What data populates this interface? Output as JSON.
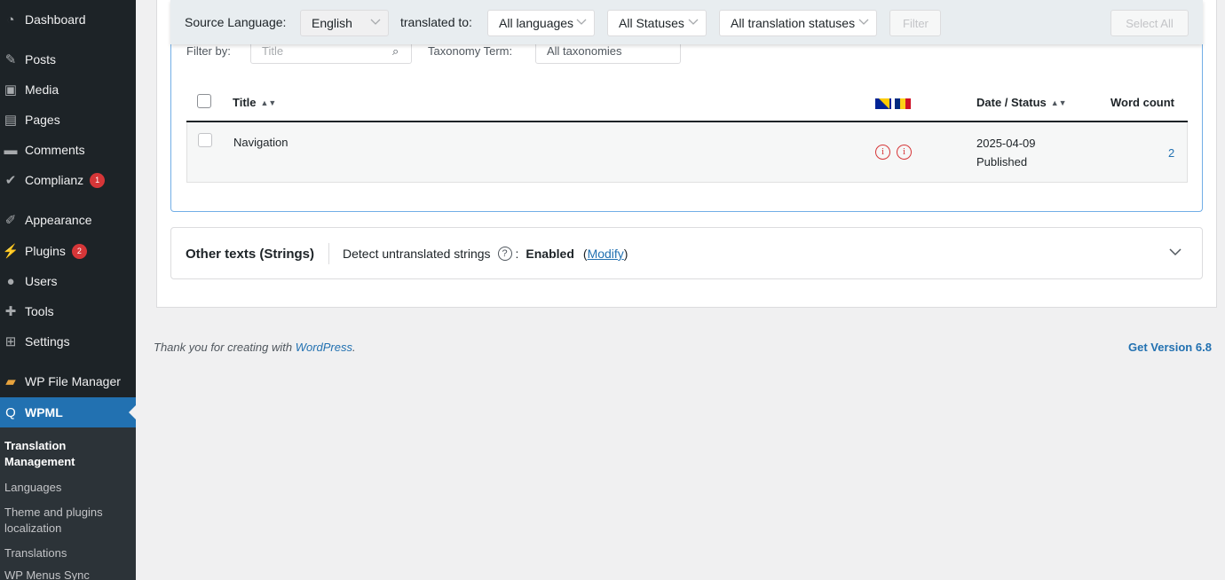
{
  "sidebar": {
    "items": [
      {
        "label": "Dashboard",
        "icon": "dashboard-icon"
      },
      {
        "label": "Posts",
        "icon": "pin-icon"
      },
      {
        "label": "Media",
        "icon": "media-icon"
      },
      {
        "label": "Pages",
        "icon": "page-icon"
      },
      {
        "label": "Comments",
        "icon": "comment-icon"
      },
      {
        "label": "Complianz",
        "icon": "check-icon",
        "badge": "1"
      },
      {
        "label": "Appearance",
        "icon": "brush-icon"
      },
      {
        "label": "Plugins",
        "icon": "plug-icon",
        "badge": "2"
      },
      {
        "label": "Users",
        "icon": "user-icon"
      },
      {
        "label": "Tools",
        "icon": "wrench-icon"
      },
      {
        "label": "Settings",
        "icon": "settings-icon"
      },
      {
        "label": "WP File Manager",
        "icon": "folder-icon"
      },
      {
        "label": "WPML",
        "icon": "wpml-icon"
      }
    ],
    "submenu": [
      "Translation Management",
      "Languages",
      "Theme and plugins localization",
      "Translations",
      "WP Menus Sync"
    ]
  },
  "toolbar": {
    "source_label": "Source Language:",
    "source_value": "English",
    "translated_label": "translated to:",
    "languages_value": "All languages",
    "statuses_value": "All Statuses",
    "translation_statuses_value": "All translation statuses",
    "filter_button": "Filter",
    "select_all_button": "Select All"
  },
  "filterby": {
    "label": "Filter by:",
    "title_placeholder": "Title",
    "taxonomy_label": "Taxonomy Term:",
    "taxonomy_value": "All taxonomies"
  },
  "table": {
    "headers": {
      "title": "Title",
      "date_status": "Date / Status",
      "word_count": "Word count"
    },
    "rows": [
      {
        "title": "Navigation",
        "date": "2025-04-09",
        "status": "Published",
        "word_count": "2"
      }
    ]
  },
  "strings": {
    "title": "Other texts (Strings)",
    "detect_label": "Detect untranslated strings",
    "help": "?",
    "colon": ":",
    "enabled": "Enabled",
    "modify": "Modify"
  },
  "footer": {
    "thanks_prefix": "Thank you for creating with ",
    "wordpress_link": "WordPress",
    "thanks_suffix": ".",
    "version": "Get Version 6.8"
  },
  "colors": {
    "accent": "#2271b1",
    "sidebar_bg": "#1d2327",
    "warning": "#d63638"
  }
}
